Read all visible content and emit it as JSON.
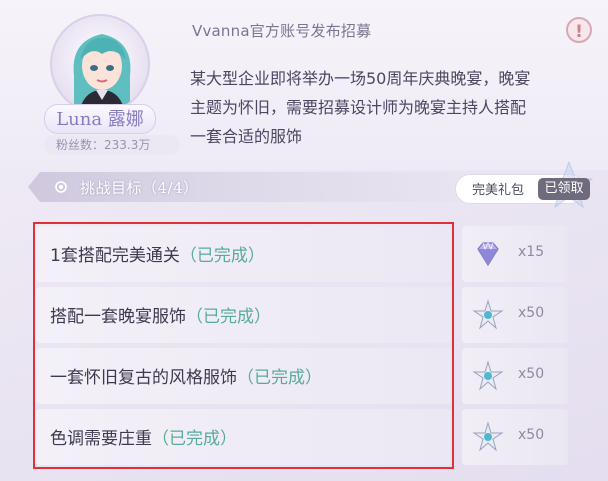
{
  "header": {
    "title": "Vvanna官方账号发布招募",
    "alert_symbol": "!"
  },
  "profile": {
    "name": "Luna 露娜",
    "fans": "粉丝数：233.3万"
  },
  "description_lines": [
    "某大型企业即将举办一场50周年庆典晚宴，晚宴",
    "主题为怀旧，需要招募设计师为晚宴主持人搭配",
    "一套合适的服饰"
  ],
  "challenge": {
    "title": "挑战目标（4/4）",
    "gift_label": "完美礼包",
    "claimed_label": "已领取"
  },
  "tasks": [
    {
      "text": "1套搭配完美通关",
      "status": "（已完成）",
      "reward_icon": "diamond-icon",
      "reward_qty": "x15"
    },
    {
      "text": "搭配一套晚宴服饰",
      "status": "（已完成）",
      "reward_icon": "star-crystal-icon",
      "reward_qty": "x50"
    },
    {
      "text": "一套怀旧复古的风格服饰",
      "status": "（已完成）",
      "reward_icon": "star-crystal-icon",
      "reward_qty": "x50"
    },
    {
      "text": "色调需要庄重",
      "status": "（已完成）",
      "reward_icon": "star-crystal-icon",
      "reward_qty": "x50"
    }
  ],
  "colors": {
    "status_green": "#57ab9b",
    "highlight_red": "#e0303a",
    "claimed_gray": "#6f6b7c"
  }
}
